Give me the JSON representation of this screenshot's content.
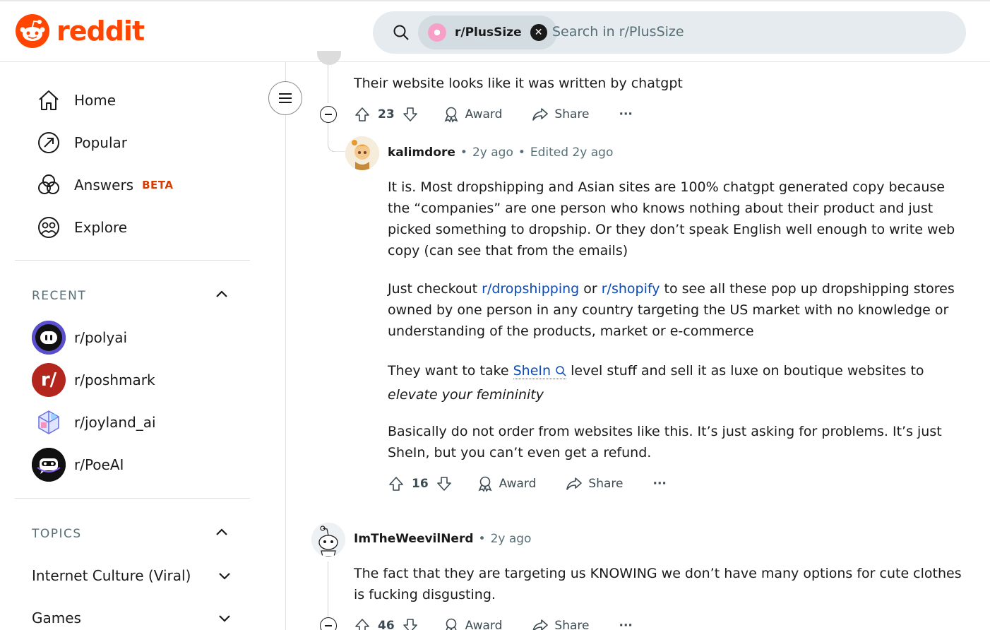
{
  "header": {
    "logo_text": "reddit",
    "search_chip_label": "r/PlusSize",
    "search_placeholder": "Search in r/PlusSize"
  },
  "sidebar": {
    "nav": [
      {
        "label": "Home"
      },
      {
        "label": "Popular"
      },
      {
        "label": "Answers",
        "badge": "BETA"
      },
      {
        "label": "Explore"
      }
    ],
    "recent_title": "RECENT",
    "recent": [
      {
        "label": "r/polyai"
      },
      {
        "label": "r/poshmark"
      },
      {
        "label": "r/joyland_ai"
      },
      {
        "label": "r/PoeAI"
      }
    ],
    "topics_title": "TOPICS",
    "topics": [
      {
        "label": "Internet Culture (Viral)"
      },
      {
        "label": "Games"
      }
    ]
  },
  "comments": {
    "c1": {
      "text": "Their website looks like it was written by chatgpt",
      "votes": "23",
      "award": "Award",
      "share": "Share",
      "more": "···"
    },
    "c2": {
      "user": "kalimdore",
      "time": "2y ago",
      "edited": "Edited 2y ago",
      "p1": "It is. Most dropshipping and Asian sites are 100% chatgpt generated copy because the “companies” are one person who knows nothing about their product and just picked something to dropship. Or they don’t speak English well enough to write web copy (can see that from the emails)",
      "p2_pre": "Just checkout ",
      "p2_link1": "r/dropshipping",
      "p2_mid": " or ",
      "p2_link2": "r/shopify",
      "p2_post": " to see all these pop up dropshipping stores owned by one person in any country targeting the US market with no knowledge or understanding of the products, market or e-commerce",
      "p3_pre": "They want to take ",
      "p3_link": "SheIn",
      "p3_mid": " level stuff and sell it as luxe on boutique websites to ",
      "p3_em": "elevate your femininity",
      "p4": "Basically do not order from websites like this. It’s just asking for problems. It’s just SheIn, but you can’t even get a refund.",
      "votes": "16",
      "award": "Award",
      "share": "Share",
      "more": "···"
    },
    "c3": {
      "user": "ImTheWeevilNerd",
      "time": "2y ago",
      "text": "The fact that they are targeting us KNOWING we don’t have many options for cute clothes is fucking disgusting.",
      "votes": "46",
      "award": "Award",
      "share": "Share",
      "more": "···"
    }
  },
  "colors": {
    "brand": "#ff4500",
    "link": "#0a4bb8",
    "beta": "#d93a00"
  }
}
